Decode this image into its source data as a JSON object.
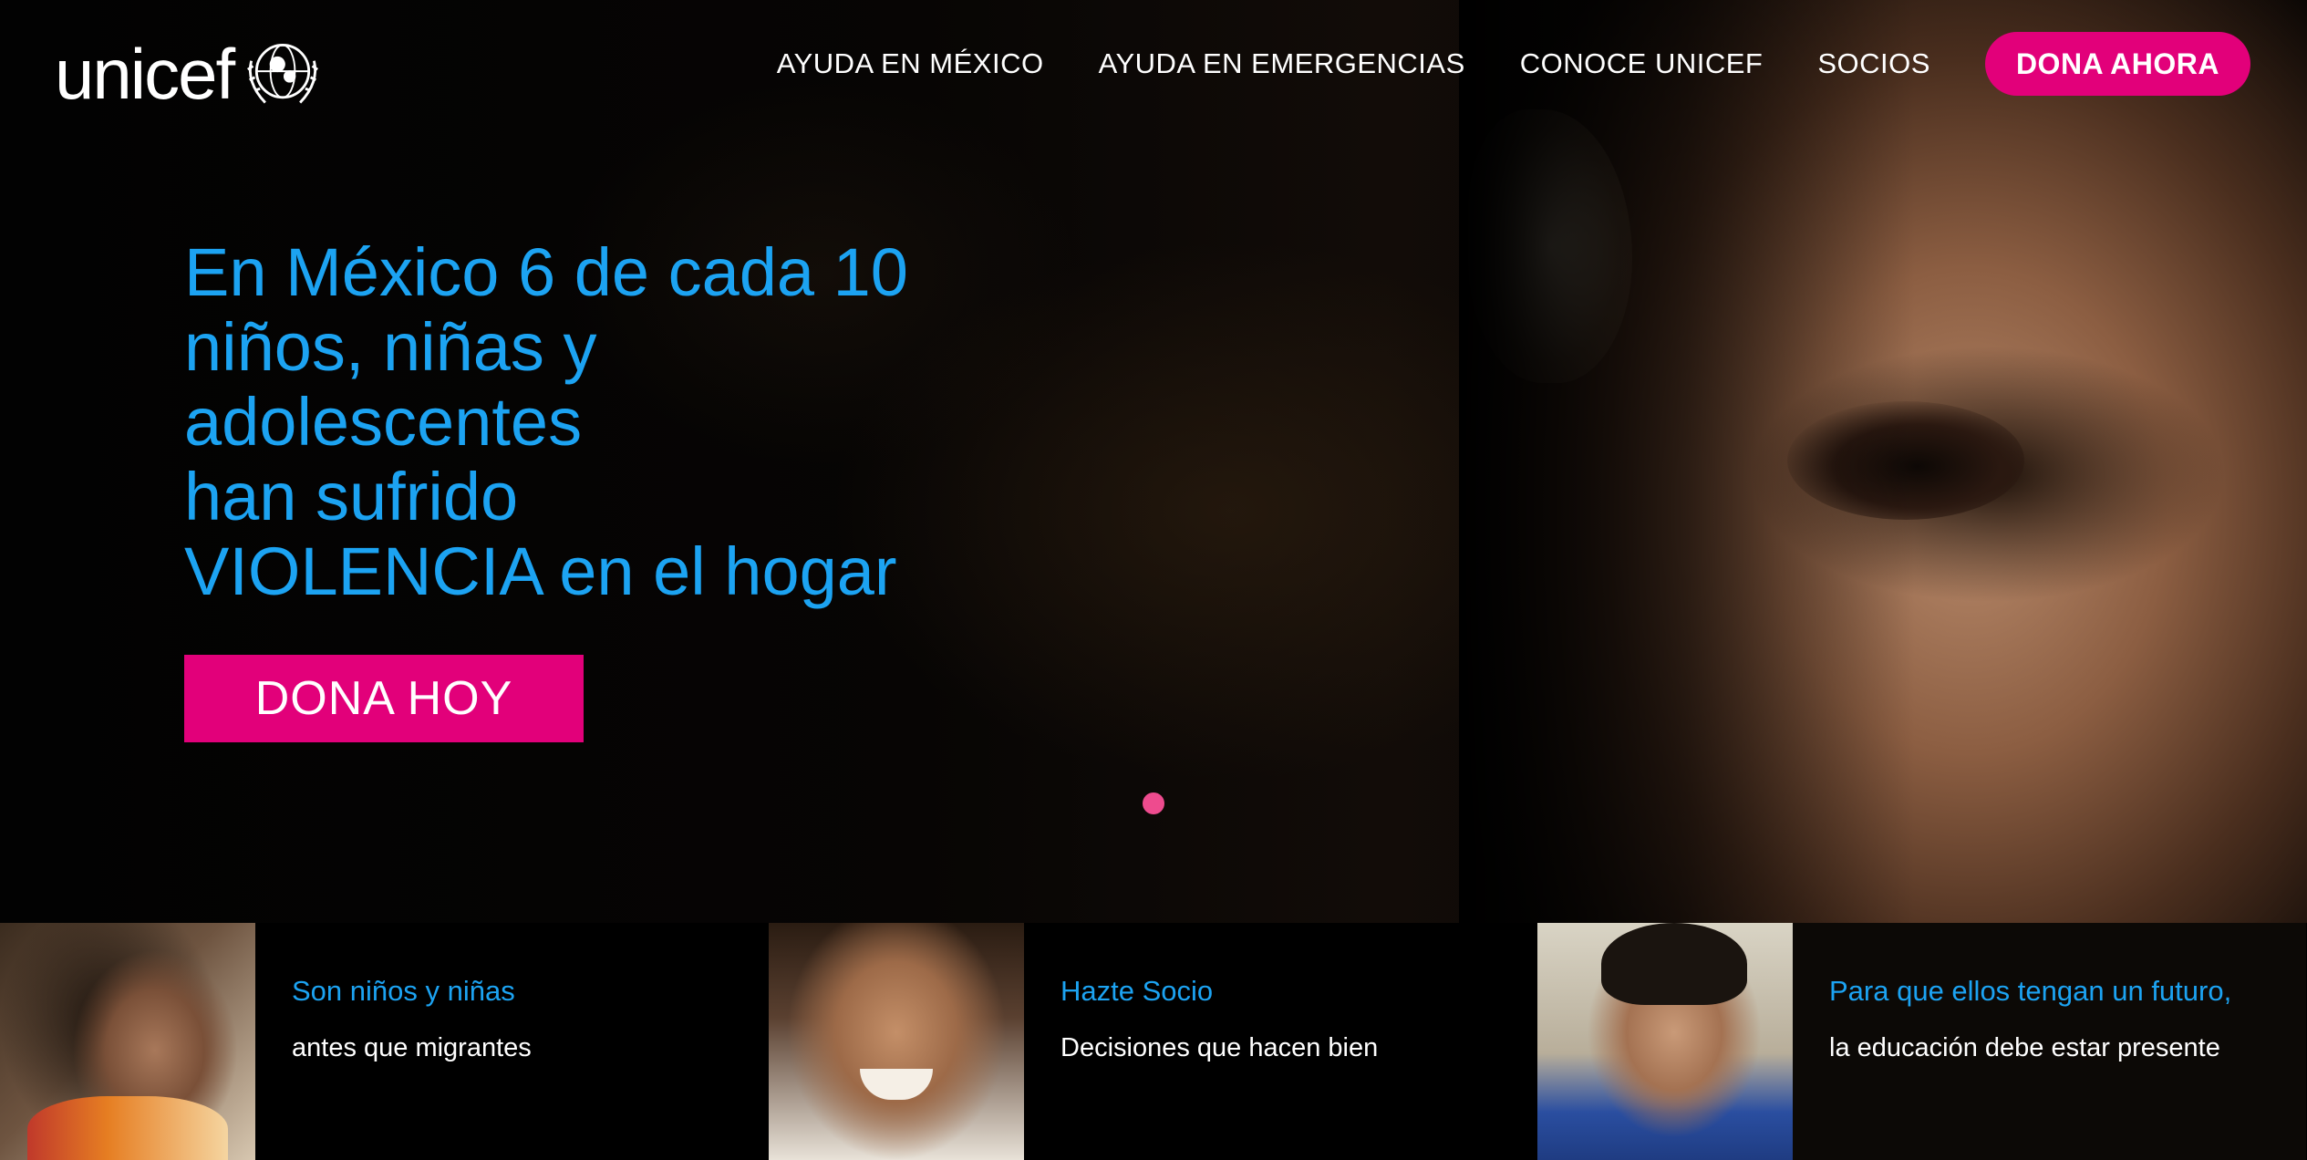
{
  "header": {
    "logo_text": "unicef",
    "nav": [
      "AYUDA EN MÉXICO",
      "AYUDA EN EMERGENCIAS",
      "CONOCE UNICEF",
      "SOCIOS"
    ],
    "donate_label": "DONA AHORA"
  },
  "hero": {
    "headline_lines": [
      "En México 6 de cada 10",
      "niños, niñas y",
      "adolescentes",
      "han sufrido",
      "VIOLENCIA en el hogar"
    ],
    "cta_label": "DONA HOY"
  },
  "cards": [
    {
      "title": "Son niños y niñas",
      "text": "antes que migrantes"
    },
    {
      "title": "Hazte Socio",
      "text": "Decisiones que hacen bien"
    },
    {
      "title": "Para que ellos tengan un futuro,",
      "text": "la educación debe estar presente"
    }
  ],
  "colors": {
    "accent_blue": "#1ca3f2",
    "brand_pink": "#e2007a",
    "slider_dot": "#ee4b8e",
    "background": "#000000"
  },
  "icons": {
    "logo": "unicef-emblem-icon"
  }
}
